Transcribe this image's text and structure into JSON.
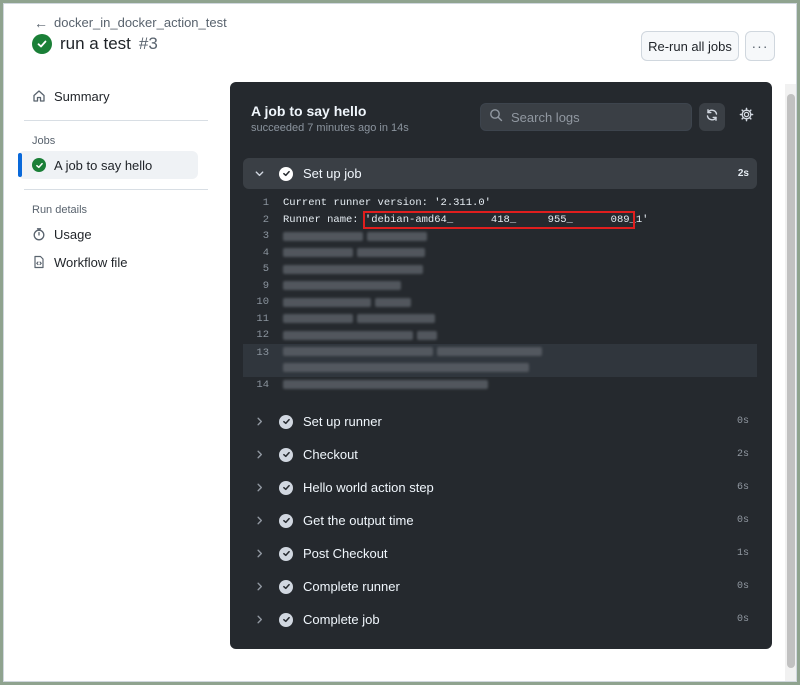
{
  "header": {
    "back_label": "docker_in_docker_action_test",
    "run_title": "run a test",
    "run_number": "#3",
    "rerun_label": "Re-run all jobs",
    "more_label": "···"
  },
  "sidebar": {
    "summary_label": "Summary",
    "jobs_heading": "Jobs",
    "job_label": "A job to say hello",
    "run_details_heading": "Run details",
    "usage_label": "Usage",
    "workflow_file_label": "Workflow file"
  },
  "panel": {
    "title": "A job to say hello",
    "subtitle": "succeeded 7 minutes ago in 14s",
    "search_placeholder": "Search logs",
    "open_step": {
      "name": "Set up job",
      "duration": "2s"
    },
    "log": {
      "line1_num": "1",
      "line1_text": "Current runner version: '2.311.0'",
      "line2_num": "2",
      "line2_text": "Runner name: 'debian-amd64_      418_     955_      089_1'",
      "hidden_line_numbers": [
        "3",
        "4",
        "5",
        "9",
        "10",
        "11",
        "12",
        "13",
        "14"
      ]
    },
    "steps": [
      {
        "name": "Set up runner",
        "duration": "0s"
      },
      {
        "name": "Checkout",
        "duration": "2s"
      },
      {
        "name": "Hello world action step",
        "duration": "6s"
      },
      {
        "name": "Get the output time",
        "duration": "0s"
      },
      {
        "name": "Post Checkout",
        "duration": "1s"
      },
      {
        "name": "Complete runner",
        "duration": "0s"
      },
      {
        "name": "Complete job",
        "duration": "0s"
      }
    ]
  },
  "colors": {
    "success": "#1a7f37",
    "accent": "#0969da",
    "highlight_box": "#e01e1e",
    "panel_bg": "#25292e"
  }
}
